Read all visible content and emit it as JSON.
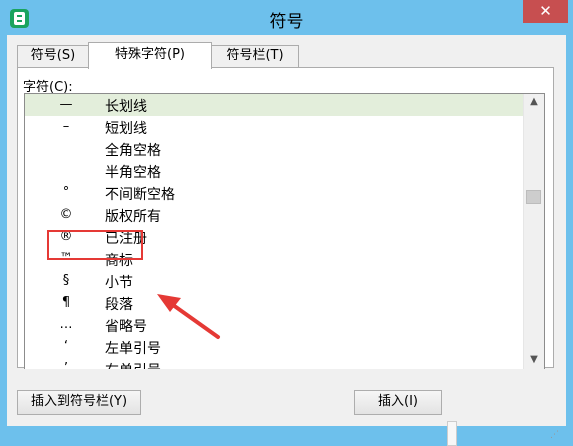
{
  "window": {
    "title": "符号",
    "close_glyph": "✕"
  },
  "tabs": [
    {
      "label": "符号(S)",
      "active": false
    },
    {
      "label": "特殊字符(P)",
      "active": true
    },
    {
      "label": "符号栏(T)",
      "active": false
    }
  ],
  "chars_label": "字符(C):",
  "rows": [
    {
      "symbol": "—",
      "name": "长划线",
      "selected": true
    },
    {
      "symbol": "–",
      "name": "短划线"
    },
    {
      "symbol": "",
      "name": "全角空格"
    },
    {
      "symbol": "",
      "name": "半角空格"
    },
    {
      "symbol": "°",
      "name": "不间断空格"
    },
    {
      "symbol": "©",
      "name": "版权所有"
    },
    {
      "symbol": "®",
      "name": "已注册"
    },
    {
      "symbol": "™",
      "name": "商标"
    },
    {
      "symbol": "§",
      "name": "小节"
    },
    {
      "symbol": "¶",
      "name": "段落"
    },
    {
      "symbol": "…",
      "name": "省略号"
    },
    {
      "symbol": "‘",
      "name": "左单引号"
    },
    {
      "symbol": "’",
      "name": "右单引号"
    }
  ],
  "scroll_position": 0.45,
  "buttons": {
    "insert_to_bar": "插入到符号栏(Y)",
    "insert": "插入(I)"
  },
  "colors": {
    "title_bar": "#6dc0ec",
    "close_button": "#c74f50",
    "selection": "#e3eedb",
    "annotation": "#e53935",
    "app_icon": "#1aa35e"
  }
}
